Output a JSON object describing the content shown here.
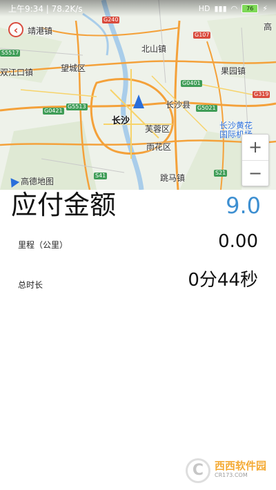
{
  "status_bar": {
    "time_speed": "上午9:34 | 78.2K/s",
    "signal": "HD",
    "battery": "76"
  },
  "map": {
    "provider_label": "高德地图",
    "zoom_in": "+",
    "zoom_out": "−",
    "places": [
      {
        "key": "jinggang",
        "text": "靖港镇"
      },
      {
        "key": "beishan",
        "text": "北山镇"
      },
      {
        "key": "gao",
        "text": "高"
      },
      {
        "key": "wangcheng",
        "text": "望城区"
      },
      {
        "key": "guoyuan",
        "text": "果园镇"
      },
      {
        "key": "shuangjiangkou",
        "text": "双江口镇"
      },
      {
        "key": "changshaxian",
        "text": "长沙县"
      },
      {
        "key": "changsha",
        "text": "长沙"
      },
      {
        "key": "furong",
        "text": "芙蓉区"
      },
      {
        "key": "airport",
        "text": "长沙黄花\n国际机场"
      },
      {
        "key": "yuhua",
        "text": "雨花区"
      },
      {
        "key": "tiaoma",
        "text": "跳马镇"
      }
    ],
    "road_shields": [
      {
        "key": "g240",
        "text": "G240",
        "color": "red"
      },
      {
        "key": "g107",
        "text": "G107",
        "color": "red"
      },
      {
        "key": "s5517",
        "text": "S5517",
        "color": "green"
      },
      {
        "key": "g0401",
        "text": "G0401",
        "color": "green"
      },
      {
        "key": "g0421",
        "text": "G0421",
        "color": "green"
      },
      {
        "key": "g5513",
        "text": "G5513",
        "color": "green"
      },
      {
        "key": "g5021",
        "text": "G5021",
        "color": "green"
      },
      {
        "key": "g319",
        "text": "G319",
        "color": "red"
      },
      {
        "key": "s41",
        "text": "S41",
        "color": "green"
      },
      {
        "key": "s21",
        "text": "S21",
        "color": "green"
      }
    ]
  },
  "trip": {
    "amount_label": "应付金额",
    "amount_value": "9.0",
    "distance_label": "里程（公里）",
    "distance_value": "0.00",
    "duration_label": "总时长",
    "duration_value": "0分44秒"
  },
  "watermark": {
    "brand": "西西软件园",
    "site": "CR173.COM"
  },
  "colors": {
    "amount": "#3d8fd1",
    "back_accent": "#d94b3d",
    "marker": "#2a6fdb"
  }
}
